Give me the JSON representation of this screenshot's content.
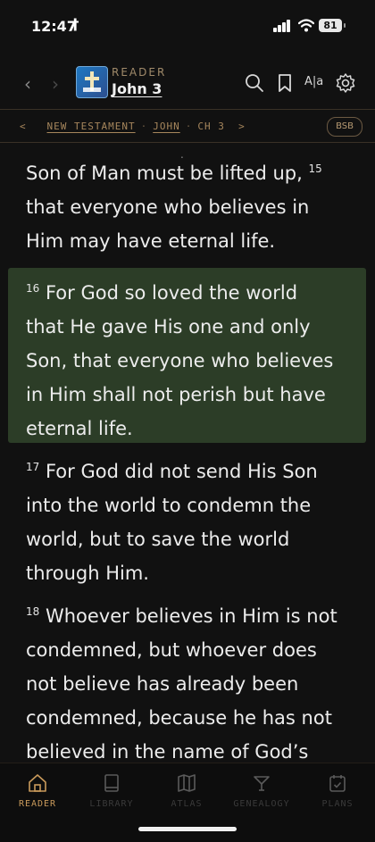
{
  "status": {
    "time": "12:47",
    "extra_icon": "†",
    "battery": "81"
  },
  "header": {
    "back_icon": "chevron-left-icon",
    "forward_icon": "chevron-right-icon",
    "kicker": "READER",
    "title": "John 3",
    "tools": [
      "search-icon",
      "bookmark-icon",
      "text-size-icon",
      "gear-icon"
    ],
    "text_size_label": "A|a"
  },
  "breadcrumb": {
    "back": "<",
    "testament": "NEW TESTAMENT",
    "separator": "·",
    "book": "JOHN",
    "chapter": "CH 3",
    "forward": ">",
    "translation": "BSB"
  },
  "reader": {
    "continuation_dot": ".",
    "partial_line1": "Son of Man must be lifted up,",
    "partial_num": "15",
    "partial_line2": "that everyone who believes in",
    "partial_line3": "Him may have eternal life.",
    "verses": [
      {
        "num": "16",
        "text": "For God so loved the world that He gave His one and only Son, that everyone who believes in Him shall not perish but have eternal life.",
        "highlighted": true
      },
      {
        "num": "17",
        "text": "For God did not send His Son into the world to condemn the world, but to save the world through Him.",
        "highlighted": false
      },
      {
        "num": "18",
        "text": "Whoever believes in Him is not condemned, but whoever does not believe has already been condemned, because he has not believed in the name of God’s one",
        "highlighted": false
      }
    ],
    "highlight_color": "#2c3d27"
  },
  "tabs": [
    {
      "label": "READER",
      "icon": "home-icon",
      "active": true
    },
    {
      "label": "LIBRARY",
      "icon": "book-icon",
      "active": false
    },
    {
      "label": "ATLAS",
      "icon": "map-icon",
      "active": false
    },
    {
      "label": "GENEALOGY",
      "icon": "family-tree-icon",
      "active": false
    },
    {
      "label": "PLANS",
      "icon": "calendar-check-icon",
      "active": false
    }
  ],
  "colors": {
    "accent": "#a6865c",
    "active_tab": "#c99a5b",
    "inactive_tab": "#4a4a4a"
  }
}
